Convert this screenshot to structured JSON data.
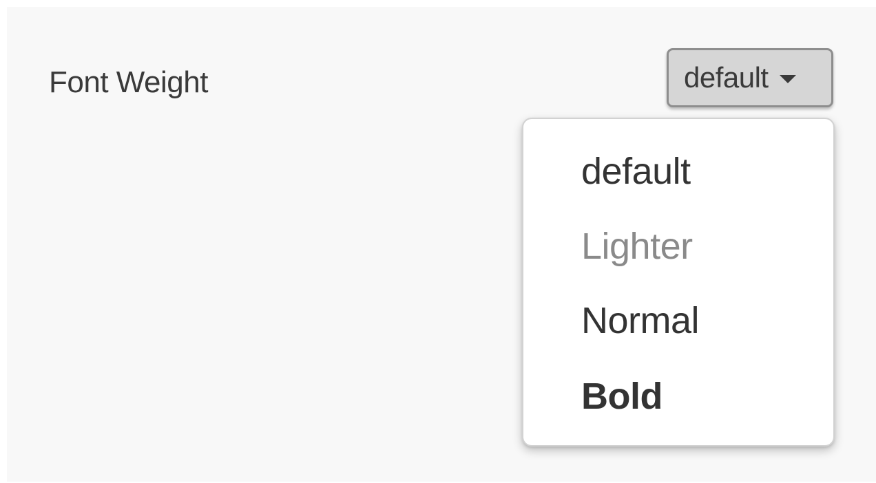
{
  "setting": {
    "label": "Font Weight"
  },
  "select": {
    "value": "default",
    "caret_icon": "caret-down-icon"
  },
  "dropdown": {
    "options": [
      {
        "label": "default",
        "weight": "default"
      },
      {
        "label": "Lighter",
        "weight": "lighter"
      },
      {
        "label": "Normal",
        "weight": "normal"
      },
      {
        "label": "Bold",
        "weight": "bold"
      }
    ]
  },
  "colors": {
    "background": "#f8f8f8",
    "select_background": "#d6d6d6",
    "select_border": "#8e8e8e",
    "text": "#333333",
    "lighter_text": "#8a8a8a"
  }
}
